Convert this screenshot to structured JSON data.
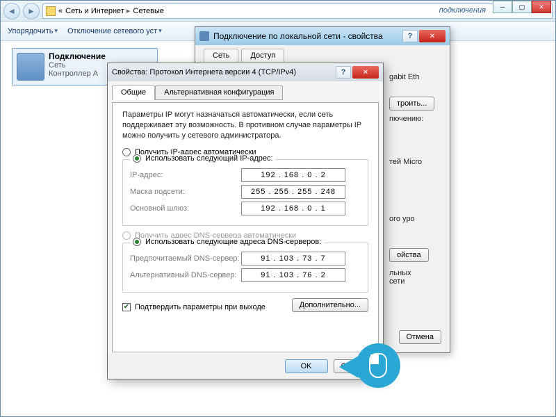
{
  "explorer": {
    "crumb1": "Сеть и Интернет",
    "crumb2": "Сетевые",
    "right_hint": "подключения",
    "toolbar": {
      "organize": "Упорядочить",
      "disable": "Отключение сетевого уст"
    },
    "connection": {
      "title": "Подключение",
      "line2": "Сеть",
      "line3": "Контроллер A"
    }
  },
  "parent_dialog": {
    "title": "Подключение по локальной сети - свойства",
    "tabs": {
      "net": "Сеть",
      "access": "Доступ"
    },
    "right": {
      "gigabit": "gabit Eth",
      "configure": "троить...",
      "connection_label": "пючению:",
      "microsoft": "тей Micro",
      "level": "ого уро",
      "properties": "ойства",
      "other": "льных\nсети"
    },
    "cancel": "Отмена"
  },
  "ipv4_dialog": {
    "title": "Свойства: Протокол Интернета версии 4 (TCP/IPv4)",
    "tabs": {
      "general": "Общие",
      "alt": "Альтернативная конфигурация"
    },
    "info": "Параметры IP могут назначаться автоматически, если сеть поддерживает эту возможность. В противном случае параметры IP можно получить у сетевого администратора.",
    "ip_section": {
      "auto": "Получить IP-адрес автоматически",
      "manual": "Использовать следующий IP-адрес:",
      "fields": {
        "ip_label": "IP-адрес:",
        "ip_value": "192 . 168 .  0  .  2",
        "mask_label": "Маска подсети:",
        "mask_value": "255 . 255 . 255 . 248",
        "gw_label": "Основной шлюз:",
        "gw_value": "192 . 168 .  0  .  1"
      }
    },
    "dns_section": {
      "auto": "Получить адрес DNS-сервера автоматически",
      "manual": "Использовать следующие адреса DNS-серверов:",
      "fields": {
        "pref_label": "Предпочитаемый DNS-сервер:",
        "pref_value": "91 . 103 .  73 .  7",
        "alt_label": "Альтернативный DNS-сервер:",
        "alt_value": "91 . 103 .  76 .  2"
      }
    },
    "validate": "Подтвердить параметры при выходе",
    "advanced": "Дополнительно...",
    "ok": "OK",
    "cancel": "Отмена"
  }
}
